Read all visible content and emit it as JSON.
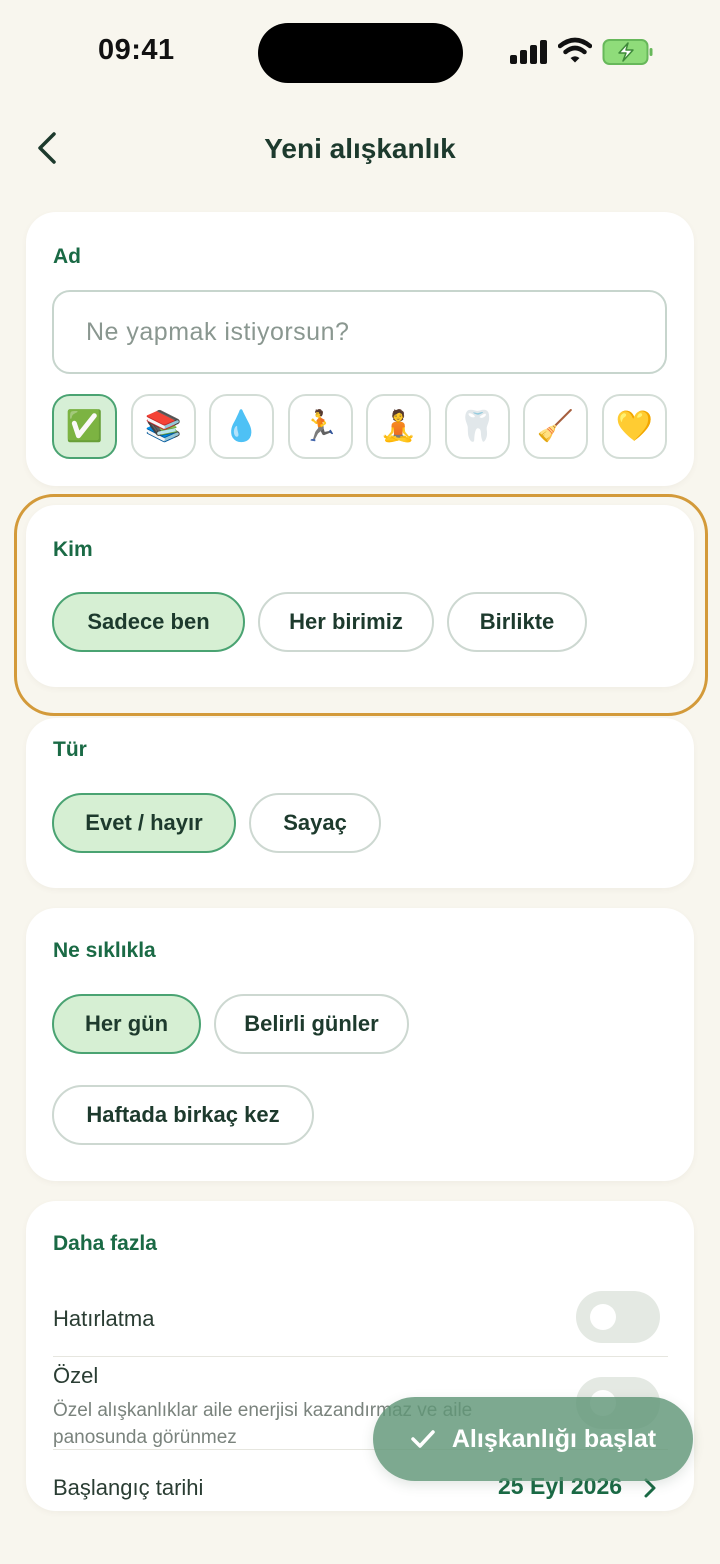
{
  "status": {
    "time": "09:41"
  },
  "header": {
    "title": "Yeni alışkanlık"
  },
  "name_section": {
    "label": "Ad",
    "placeholder": "Ne yapmak istiyorsun?",
    "emojis": [
      {
        "glyph": "✅",
        "name": "check-mark-emoji",
        "selected": true
      },
      {
        "glyph": "📚",
        "name": "books-emoji",
        "selected": false
      },
      {
        "glyph": "💧",
        "name": "droplet-emoji",
        "selected": false
      },
      {
        "glyph": "🏃",
        "name": "runner-emoji",
        "selected": false
      },
      {
        "glyph": "🧘",
        "name": "meditation-emoji",
        "selected": false
      },
      {
        "glyph": "🦷",
        "name": "tooth-emoji",
        "selected": false
      },
      {
        "glyph": "🧹",
        "name": "broom-emoji",
        "selected": false
      },
      {
        "glyph": "💛",
        "name": "yellow-heart-emoji",
        "selected": false
      }
    ]
  },
  "who_section": {
    "label": "Kim",
    "options": [
      "Sadece ben",
      "Her birimiz",
      "Birlikte"
    ],
    "selected": "Sadece ben"
  },
  "type_section": {
    "label": "Tür",
    "options": [
      "Evet / hayır",
      "Sayaç"
    ],
    "selected": "Evet / hayır"
  },
  "frequency_section": {
    "label": "Ne sıklıkla",
    "options": [
      "Her gün",
      "Belirli günler",
      "Haftada birkaç kez"
    ],
    "selected": "Her gün"
  },
  "more_section": {
    "label": "Daha fazla",
    "reminder_label": "Hatırlatma",
    "reminder_on": false,
    "private_label": "Özel",
    "private_hint": "Özel alışkanlıklar aile enerjisi kazandırmaz ve aile panosunda görünmez",
    "private_on": false,
    "start_date_label": "Başlangıç tarihi",
    "start_date_value": "25 Eyl 2026"
  },
  "start_button": {
    "label": "Alışkanlığı başlat"
  },
  "colors": {
    "accent": "#1a6a45",
    "chip_active_bg": "#d6efd3",
    "highlight": "#d39a3a",
    "background": "#f8f6ee"
  }
}
